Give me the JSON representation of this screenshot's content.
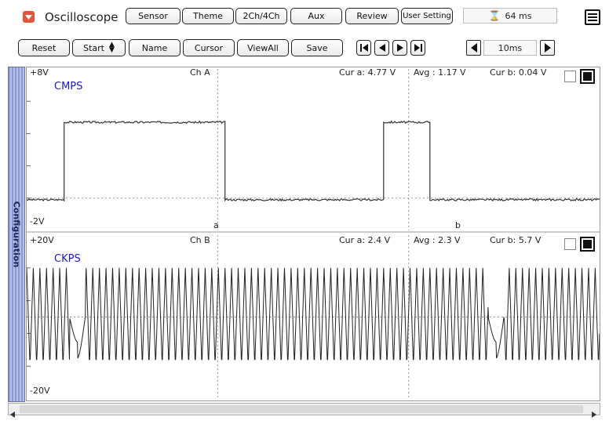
{
  "app": {
    "title": "Oscilloscope",
    "timer": "64 ms"
  },
  "topmenu": [
    "Sensor",
    "Theme",
    "2Ch/4Ch",
    "Aux",
    "Review",
    "User Setting"
  ],
  "toolbar": {
    "reset": "Reset",
    "start": "Start",
    "name": "Name",
    "cursor": "Cursor",
    "viewall": "ViewAll",
    "save": "Save",
    "timebase": "10ms"
  },
  "sidebar": {
    "label": "Configuration"
  },
  "channels": [
    {
      "name": "Ch A",
      "sensor": "CMPS",
      "vmax": "+8V",
      "vmin": "-2V",
      "cur_a": "Cur a: 4.77 V",
      "avg": "Avg : 1.17 V",
      "cur_b": "Cur b: 0.04 V",
      "cursor_a": "a",
      "cursor_b": "b"
    },
    {
      "name": "Ch B",
      "sensor": "CKPS",
      "vmax": "+20V",
      "vmin": "-20V",
      "cur_a": "Cur a: 2.4 V",
      "avg": "Avg : 2.3 V",
      "cur_b": "Cur b: 5.7 V"
    }
  ],
  "chart_data": [
    {
      "type": "line",
      "series": [
        {
          "name": "CMPS",
          "x": [
            0,
            8.5,
            8.5,
            45,
            45,
            81,
            81,
            91.5,
            91.5,
            130
          ],
          "y": [
            -0.1,
            -0.1,
            4.7,
            4.7,
            -0.1,
            -0.1,
            4.7,
            4.7,
            -0.1,
            -0.1
          ]
        }
      ],
      "xlabel": "",
      "ylabel": "",
      "xlim": [
        0,
        130
      ],
      "ylim": [
        -2,
        8
      ],
      "colors": {
        "trace": "#333333",
        "grid": "#9a9a9a"
      }
    },
    {
      "type": "line",
      "series": [
        {
          "name": "CKPS",
          "pattern": "oscillating +/-12 V with missing-tooth gaps",
          "gaps_ms": [
            11.5,
            106.5
          ],
          "amplitude_v": 12,
          "period_ms": 1.5
        }
      ],
      "xlabel": "",
      "ylabel": "",
      "xlim": [
        0,
        130
      ],
      "ylim": [
        -20,
        20
      ],
      "colors": {
        "trace": "#222222",
        "grid": "#9a9a9a"
      }
    }
  ]
}
